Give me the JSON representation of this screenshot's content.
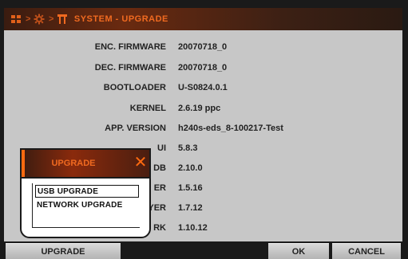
{
  "header": {
    "title": "SYSTEM - UPGRADE",
    "icons": [
      "menu-grid-icon",
      "gear-icon",
      "tools-icon"
    ],
    "accent_color": "#f06a20"
  },
  "info_rows": [
    {
      "label": "ENC. FIRMWARE",
      "value": "20070718_0"
    },
    {
      "label": "DEC. FIRMWARE",
      "value": "20070718_0"
    },
    {
      "label": "BOOTLOADER",
      "value": "U-S0824.0.1"
    },
    {
      "label": "KERNEL",
      "value": "2.6.19 ppc"
    },
    {
      "label": "APP. VERSION",
      "value": "h240s-eds_8-100217-Test"
    },
    {
      "label": "UI",
      "value": "5.8.3"
    },
    {
      "label": "DB",
      "value": "2.10.0"
    },
    {
      "label": "ER",
      "value": "1.5.16"
    },
    {
      "label": "YER",
      "value": "1.7.12"
    },
    {
      "label": "RK",
      "value": "1.10.12"
    }
  ],
  "buttons": {
    "upgrade": "UPGRADE",
    "ok": "OK",
    "cancel": "CANCEL"
  },
  "dialog": {
    "title": "UPGRADE",
    "close": "✕",
    "options": [
      "USB UPGRADE",
      "NETWORK UPGRADE"
    ],
    "selected_index": 0
  }
}
